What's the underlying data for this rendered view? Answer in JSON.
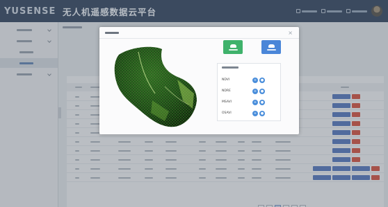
{
  "app": {
    "brand": "YUSENSE",
    "title": "无人机遥感数据云平台"
  },
  "sidebar": {
    "items": [
      {
        "depth": 0,
        "chevron": true,
        "active": false
      },
      {
        "depth": 0,
        "chevron": true,
        "active": false
      },
      {
        "depth": 1,
        "chevron": false,
        "active": false
      },
      {
        "depth": 1,
        "chevron": false,
        "active": true
      },
      {
        "depth": 0,
        "chevron": true,
        "active": false
      }
    ]
  },
  "table": {
    "row_count": 10
  },
  "modal": {
    "close_glyph": "×",
    "primary_button_color": "#3fb26b",
    "secondary_button_color": "#4a86d8",
    "indices": [
      {
        "name": "NDVI"
      },
      {
        "name": "NDRE"
      },
      {
        "name": "MSAVI"
      },
      {
        "name": "OSAVI"
      }
    ]
  },
  "colors": {
    "header": "#2c3e5a",
    "action_blue": "#4d70b8",
    "action_red": "#cf4b3a",
    "icon_blue": "#4a8edb"
  }
}
